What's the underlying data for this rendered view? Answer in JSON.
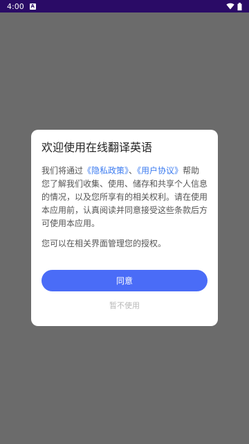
{
  "status_bar": {
    "time": "4:00",
    "notification_glyph": "A",
    "icons": [
      "wifi-icon",
      "battery-icon"
    ],
    "color": "#2a0b66"
  },
  "dialog": {
    "title": "欢迎使用在线翻译英语",
    "body_prefix": "我们将通过",
    "privacy_link": "《隐私政策》",
    "separator": "、",
    "agreement_link": "《用户协议》",
    "body_suffix": "帮助您了解我们收集、使用、储存和共享个人信息的情况，以及您所享有的相关权利。请在使用本应用前，认真阅读并同意接受这些条款后方可使用本应用。",
    "note": "您可以在相关界面管理您的授权。",
    "agree_label": "同意",
    "decline_label": "暂不使用",
    "accent_color": "#4a6cf7",
    "link_color": "#3b7bf0"
  }
}
